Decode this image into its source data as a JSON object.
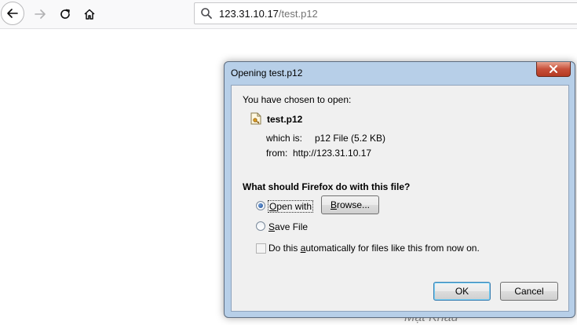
{
  "browser": {
    "url_host": "123.31.10.17",
    "url_path": "/test.p12",
    "icons": [
      "back-icon",
      "forward-icon",
      "reload-icon",
      "home-icon",
      "search-icon"
    ]
  },
  "dialog": {
    "title": "Opening test.p12",
    "intro": "You have chosen to open:",
    "file_name": "test.p12",
    "which_is_label": "which is:",
    "which_is_value": "p12 File (5.2 KB)",
    "from_label": "from:",
    "from_value": "http://123.31.10.17",
    "question": "What should Firefox do with this file?",
    "open_with_label": {
      "accel": "O",
      "rest": "pen with"
    },
    "browse_label": {
      "accel": "B",
      "rest": "rowse..."
    },
    "save_file_label": {
      "accel": "S",
      "rest": "ave File"
    },
    "auto_label": {
      "pre": "Do this ",
      "accel": "a",
      "rest": "utomatically for files like this from now on."
    },
    "ok_label": "OK",
    "cancel_label": "Cancel",
    "selected_option": "Open with",
    "auto_checked": false
  },
  "colors": {
    "dialog_frame": "#b7cfe8",
    "close_button": "#c7503a",
    "url_path": "#737373"
  }
}
